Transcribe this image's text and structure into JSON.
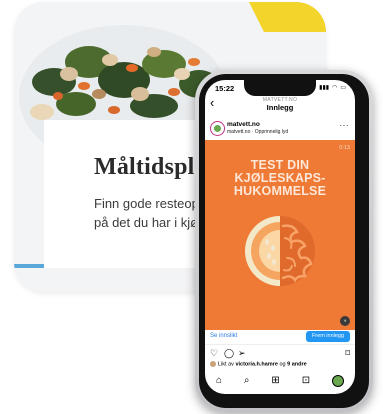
{
  "card": {
    "title": "Måltidsplanle",
    "text_lines": [
      "Finn gode resteoppskrif",
      "på det du har i kjøleskap"
    ]
  },
  "phone": {
    "status": {
      "time": "15:22"
    },
    "nav": {
      "account": "MATVETT.NO",
      "title": "Innlegg"
    },
    "post": {
      "username": "matvett.no",
      "subtitle": "matvett.no · Opprinnelig lyd",
      "video_time": "0:13",
      "headline_lines": [
        "TEST DIN",
        "KJØLESKAPS-",
        "HUKOMMELSE"
      ],
      "cta_label": "Se innslikt",
      "cta_button": "Frem innlegg",
      "likes_prefix": "Likt av ",
      "likes_user": "victoria.h.hamre",
      "likes_mid": " og ",
      "likes_count": "9 andre"
    }
  },
  "icons": {
    "back": "back-arrow-icon",
    "more": "more-icon",
    "like": "heart-icon",
    "comment": "comment-icon",
    "share": "share-icon",
    "save": "bookmark-icon",
    "tabs": [
      "home-icon",
      "search-icon",
      "create-icon",
      "shop-icon",
      "profile-icon"
    ]
  },
  "colors": {
    "post_orange": "#ee7a36",
    "cta_blue": "#2196f3",
    "headline": "#fde7d8"
  }
}
